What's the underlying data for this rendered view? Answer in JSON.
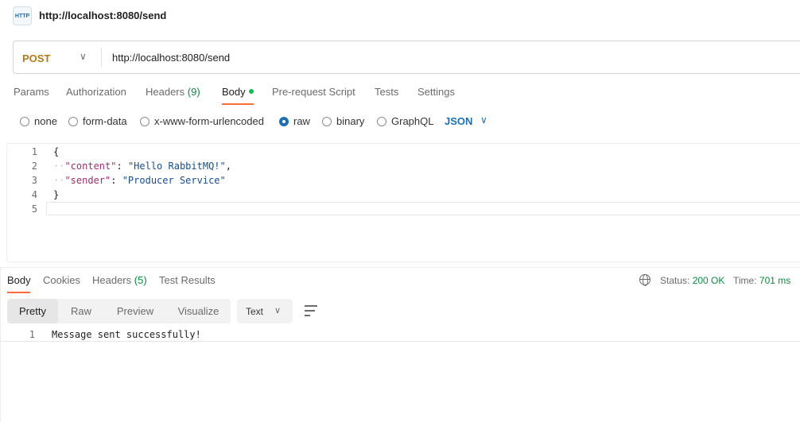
{
  "titlebar": {
    "icon_text": "HTTP",
    "title": "http://localhost:8080/send"
  },
  "request": {
    "method": "POST",
    "url": "http://localhost:8080/send"
  },
  "request_tabs": [
    {
      "label": "Params"
    },
    {
      "label": "Authorization"
    },
    {
      "label": "Headers",
      "count": "(9)"
    },
    {
      "label": "Body"
    },
    {
      "label": "Pre-request Script"
    },
    {
      "label": "Tests"
    },
    {
      "label": "Settings"
    }
  ],
  "body_types": [
    {
      "label": "none",
      "selected": false
    },
    {
      "label": "form-data",
      "selected": false
    },
    {
      "label": "x-www-form-urlencoded",
      "selected": false
    },
    {
      "label": "raw",
      "selected": true
    },
    {
      "label": "binary",
      "selected": false
    },
    {
      "label": "GraphQL",
      "selected": false
    }
  ],
  "raw_format": "JSON",
  "editor": {
    "line_numbers": [
      "1",
      "2",
      "3",
      "4",
      "5"
    ],
    "brace_open": "{",
    "brace_close": "}",
    "line2": {
      "key": "\"content\"",
      "colon": ": ",
      "value": "\"Hello RabbitMQ!\"",
      "comma": ","
    },
    "line3": {
      "key": "\"sender\"",
      "colon": ": ",
      "value": "\"Producer Service\""
    }
  },
  "response_tabs": [
    {
      "label": "Body"
    },
    {
      "label": "Cookies"
    },
    {
      "label": "Headers",
      "count": "(5)"
    },
    {
      "label": "Test Results"
    }
  ],
  "response_meta": {
    "status_label": "Status:",
    "status_value": "200 OK",
    "time_label": "Time:",
    "time_value": "701 ms"
  },
  "view_modes": [
    "Pretty",
    "Raw",
    "Preview",
    "Visualize"
  ],
  "response_format": "Text",
  "response_body": {
    "line_number": "1",
    "text": "Message sent successfully!"
  },
  "colors": {
    "method_post": "#b07a1a",
    "accent": "#ff6c37",
    "link_blue": "#1f6fb2",
    "status_green": "#0a8a3f",
    "body_dot": "#0cbb52"
  }
}
